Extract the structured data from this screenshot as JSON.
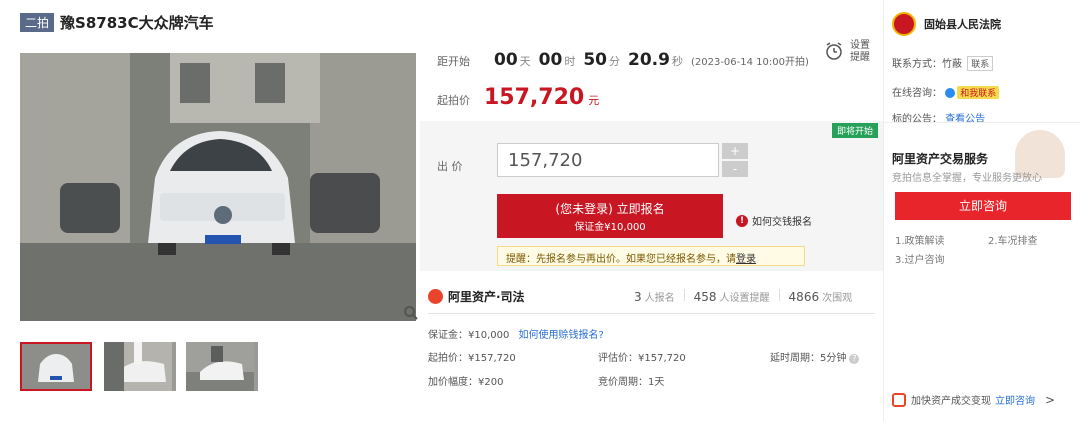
{
  "title": {
    "tag": "二拍",
    "text": "豫S8783C大众牌汽车"
  },
  "countdown": {
    "label": "距开始",
    "days": "00",
    "days_unit": "天",
    "hours": "00",
    "hours_unit": "时",
    "minutes": "50",
    "minutes_unit": "分",
    "seconds": "20.9",
    "seconds_unit": "秒",
    "start_time": "(2023-06-14 10:00开拍)"
  },
  "remind": {
    "label": "设置提醒"
  },
  "start_price": {
    "label": "起拍价",
    "value": "157,720",
    "unit": "元"
  },
  "bid": {
    "soon_tag": "即将开始",
    "label": "出 价",
    "value": "157,720",
    "plus": "+",
    "minus": "-",
    "signup_main": "(您未登录) 立即报名",
    "signup_sub": "保证金¥10,000",
    "how_bail": "如何交钱报名",
    "remind_text": "提醒：先报名参与再出价。如果您已经报名参与，请",
    "remind_link": "登录"
  },
  "brand": {
    "name": "阿里资产·司法"
  },
  "stats": {
    "signups": "3",
    "signups_label": "人报名",
    "reminders": "458",
    "reminders_label": "人设置提醒",
    "views": "4866",
    "views_label": "次围观"
  },
  "details": {
    "deposit": "保证金：¥10,000",
    "deposit_link": "如何使用赊钱报名?",
    "start_price": "起拍价：¥157,720",
    "appraisal": "评估价：¥157,720",
    "delay": "延时周期：5分钟",
    "increment": "加价幅度：¥200",
    "cycle": "竞价周期：1天"
  },
  "court": {
    "name": "固始县人民法院",
    "contact_label": "联系方式：竹蔽",
    "contact_chip": "联系",
    "online_label": "在线咨询：",
    "online_chip": "和我联系",
    "notice_label": "标的公告：",
    "notice_link": "查看公告"
  },
  "service": {
    "title": "阿里资产交易服务",
    "subtitle": "竞拍信息全掌握，专业服务更放心",
    "consult_btn": "立即咨询",
    "item1": "1.政策解读",
    "item2": "2.车况排查",
    "item3": "3.过户咨询"
  },
  "bottom": {
    "text": "加快资产成交变现",
    "link": "立即咨询",
    "chev": ">"
  },
  "colors": {
    "accent": "#c81623",
    "link": "#2a6fd6",
    "soon": "#27a15a"
  },
  "icons": {
    "remind": "alarm-clock-icon",
    "zoom": "magnifier-icon",
    "brand": "ali-asset-logo-icon"
  }
}
